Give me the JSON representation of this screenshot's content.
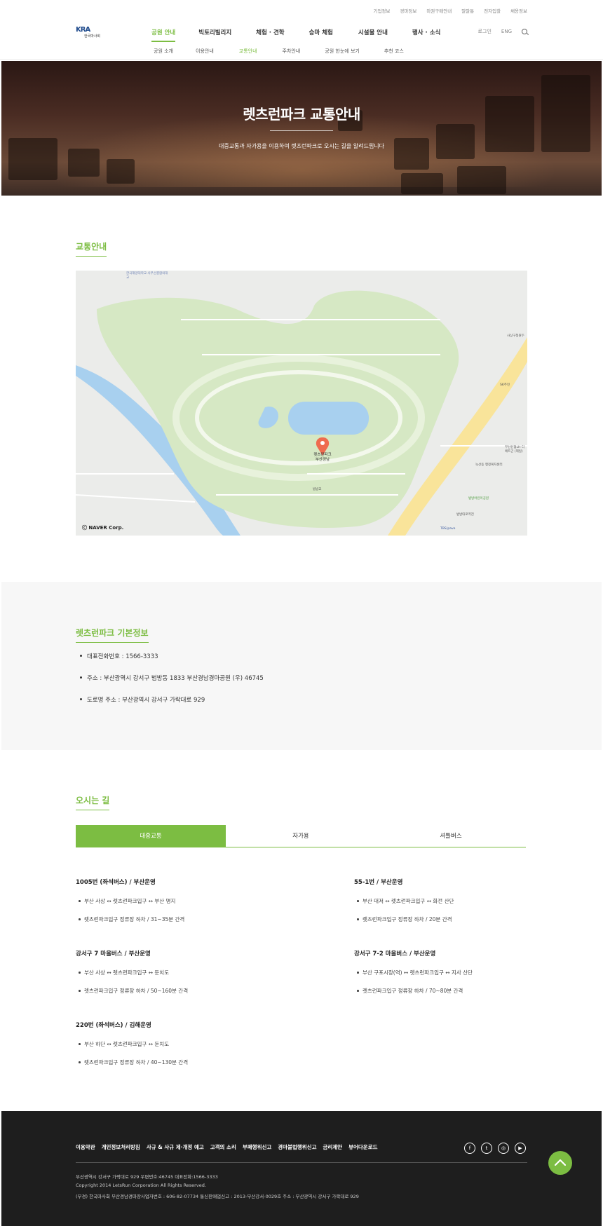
{
  "utility_links": [
    "기업정보",
    "경마정보",
    "마권구매안내",
    "말말통",
    "전자입찰",
    "채용정보"
  ],
  "logo": {
    "mark": "KRA",
    "sub": "한국마사회"
  },
  "gnb": [
    "공원 안내",
    "빅토리빌리지",
    "체험 · 견학",
    "승마 체험",
    "시설물 안내",
    "행사 · 소식"
  ],
  "gnb_right": {
    "login": "로그인",
    "lang": "ENG"
  },
  "subnav": [
    "공원 소개",
    "이용안내",
    "교통안내",
    "주차안내",
    "공원 한눈에 보기",
    "추천 코스"
  ],
  "hero": {
    "title": "렛츠런파크 교통안내",
    "subtitle": "대중교통과 자가용을 이용하여 렛츠런파크로 오시는 길을 알려드립니다"
  },
  "section_traffic": {
    "title": "교통안내"
  },
  "map": {
    "marker_label_1": "렛츠런파크",
    "marker_label_2": "부산경남",
    "copyright": "ⓒ NAVER Corp.",
    "labels": [
      "한국해양대학교 사무선결합의대교",
      "사상구청원두",
      "SK주민",
      "부산신협LH 디에트곤 (제일)",
      "녹산동 행정복지센터",
      "범방어린이공원",
      "범방대로역전",
      "범방교",
      "TBS(pave"
    ]
  },
  "section_info": {
    "title": "렛츠런파크 기본정보",
    "items": [
      "대표전화번호 : 1566-3333",
      "주소 : 부산광역시 강서구 범방동 1833 부산경남경마공원 (우) 46745",
      "도로명 주소 : 부산광역시 강서구 가락대로 929"
    ]
  },
  "section_directions": {
    "title": "오시는 길",
    "tabs": [
      "대중교통",
      "자가용",
      "셔틀버스"
    ],
    "routes": [
      {
        "title": "1005번 (좌석버스) / 부산운영",
        "lines": [
          "부산 사상 ↔ 렛츠런파크입구 ↔ 부산 명지",
          "렛츠런파크입구 정류장 하차 / 31~35분 간격"
        ]
      },
      {
        "title": "55-1번 / 부산운영",
        "lines": [
          "부산 대저 ↔ 렛츠런파크입구 ↔ 화전 산단",
          "렛츠런파크입구 정류장 하차 / 20분 간격"
        ]
      },
      {
        "title": "강서구 7 마을버스 / 부산운영",
        "lines": [
          "부산 사상 ↔ 렛츠런파크입구 ↔ 둔치도",
          "렛츠런파크입구 정류장 하차 / 50~160분 간격"
        ]
      },
      {
        "title": "강서구 7-2 마을버스 / 부산운영",
        "lines": [
          "부산 구포시장(역) ↔ 렛츠런파크입구 ↔ 지사 산단",
          "렛츠런파크입구 정류장 하차 / 70~80분 간격"
        ]
      },
      {
        "title": "220번 (좌석버스) / 김해운영",
        "lines": [
          "부산 하단 ↔ 렛츠런파크입구 ↔ 둔치도",
          "렛츠런파크입구 정류장 하차 / 40~130분 간격"
        ]
      }
    ]
  },
  "footer": {
    "links": [
      "이용약관",
      "개인정보처리방침",
      "사규 & 사규 제·개정 예고",
      "고객의 소리",
      "부패행위신고",
      "경마불법행위신고",
      "금리제안",
      "뷰어다운로드"
    ],
    "address": "부산광역시 강서구 가락대로 929     우편번호:46745     대표전화:1566-3333",
    "copyright": "Copyright 2014 LetsRun Corporation All Rights Reserved.",
    "business": "(부경) 한국마사회 부산경남경마장사업자번호 : 606-82-07734     통신판매업신고 : 2013-부산강서-0029호     주소 : 부산광역시 강서구 가락대로 929",
    "social": [
      "facebook-icon",
      "twitter-icon",
      "instagram-icon",
      "youtube-icon"
    ]
  },
  "colors": {
    "accent": "#7cbd42",
    "footer_bg": "#1e1e1e",
    "map_green": "#d6e8c4",
    "map_water": "#a8d0ef"
  }
}
